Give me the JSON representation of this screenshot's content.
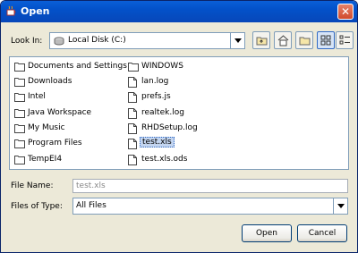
{
  "window": {
    "title": "Open",
    "close_label": "✕"
  },
  "look_in": {
    "label": "Look In:",
    "value": "Local Disk (C:)"
  },
  "files": {
    "column1": [
      {
        "name": "Documents and Settings",
        "type": "folder"
      },
      {
        "name": "Downloads",
        "type": "folder"
      },
      {
        "name": "Intel",
        "type": "folder"
      },
      {
        "name": "Java Workspace",
        "type": "folder"
      },
      {
        "name": "My Music",
        "type": "folder"
      },
      {
        "name": "Program Files",
        "type": "folder"
      },
      {
        "name": "TempEI4",
        "type": "folder"
      }
    ],
    "column2": [
      {
        "name": "WINDOWS",
        "type": "folder"
      },
      {
        "name": "lan.log",
        "type": "file"
      },
      {
        "name": "prefs.js",
        "type": "file"
      },
      {
        "name": "realtek.log",
        "type": "file"
      },
      {
        "name": "RHDSetup.log",
        "type": "file"
      },
      {
        "name": "test.xls",
        "type": "file",
        "selected": true
      },
      {
        "name": "test.xls.ods",
        "type": "file"
      }
    ]
  },
  "file_name": {
    "label": "File Name:",
    "value": "test.xls"
  },
  "file_type": {
    "label": "Files of Type:",
    "value": "All Files"
  },
  "buttons": {
    "open": "Open",
    "cancel": "Cancel"
  },
  "colors": {
    "title_bar": "#0351c9",
    "selection": "#c3d5f0",
    "window_bg": "#ece9d8"
  }
}
